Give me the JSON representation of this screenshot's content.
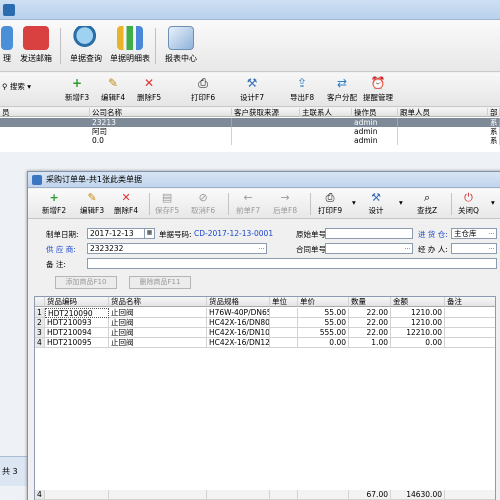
{
  "bg_app": {
    "big_toolbar": [
      {
        "label": "理",
        "icon": "settings-icon"
      },
      {
        "label": "发送邮箱",
        "icon": "mail-icon"
      },
      {
        "label": "单据查询",
        "icon": "search-icon"
      },
      {
        "label": "单据明细表",
        "icon": "bar-chart-icon"
      },
      {
        "label": "报表中心",
        "icon": "report-icon"
      }
    ],
    "search_label": "搜索",
    "toolbar": [
      {
        "label": "新增F3",
        "icon": "+"
      },
      {
        "label": "编辑F4",
        "icon": "✎"
      },
      {
        "label": "删除F5",
        "icon": "✕"
      },
      {
        "label": "打印F6",
        "icon": "⎙"
      },
      {
        "label": "设计F7",
        "icon": "⚒"
      },
      {
        "label": "导出F8",
        "icon": "⇪"
      },
      {
        "label": "客户分配",
        "icon": "⇄"
      },
      {
        "label": "提醒管理",
        "icon": "⏰"
      }
    ],
    "grid": {
      "headers": [
        "员",
        "公司名称",
        "客户获取来源",
        "主联系人",
        "操作员",
        "跟单人员",
        "部"
      ],
      "rows": [
        {
          "company": "23213",
          "operator": "admin",
          "dept": "系"
        },
        {
          "company": "阿司",
          "operator": "admin",
          "dept": "系"
        },
        {
          "company": "0.0",
          "operator": "admin",
          "dept": "系"
        }
      ]
    },
    "bottom_tab": "共 3"
  },
  "order_window": {
    "title": "采购订单单-共1张此类单据",
    "toolbar": [
      {
        "label": "新增F2",
        "icon": "+",
        "enabled": true
      },
      {
        "label": "编辑F3",
        "icon": "✎",
        "enabled": true
      },
      {
        "label": "删除F4",
        "icon": "✕",
        "enabled": true
      },
      {
        "label": "保存F5",
        "icon": "▤",
        "enabled": false
      },
      {
        "label": "取消F6",
        "icon": "⊘",
        "enabled": false
      },
      {
        "label": "前单F7",
        "icon": "←",
        "enabled": false
      },
      {
        "label": "后单F8",
        "icon": "→",
        "enabled": false
      },
      {
        "label": "打印F9",
        "icon": "⎙",
        "enabled": true
      },
      {
        "label": "设计",
        "icon": "⚒",
        "enabled": true
      },
      {
        "label": "查找Z",
        "icon": "⌕",
        "enabled": true
      },
      {
        "label": "关闭Q",
        "icon": "⏻",
        "enabled": true
      }
    ],
    "form": {
      "date_label": "制单日期:",
      "date_value": "2017-12-13",
      "doc_no_label": "单据号码:",
      "doc_no_value": "CD-2017-12-13-0001",
      "source_no_label": "原始单号:",
      "source_no_value": "",
      "warehouse_label": "进 货 仓:",
      "warehouse_value": "主仓库",
      "supplier_label": "供 应 商:",
      "supplier_value": "2323232",
      "contract_label": "合同单号:",
      "contract_value": "",
      "handler_label": "经 办 人:",
      "handler_value": "",
      "remark_label": "备    注:",
      "remark_value": "",
      "add_item_button": "添加商品F10",
      "delete_item_button": "删除商品F11"
    },
    "items": {
      "headers": [
        "",
        "货品编码",
        "货品名称",
        "货品规格",
        "单位",
        "单价",
        "数量",
        "金额",
        "备注"
      ],
      "rows": [
        {
          "n": "1",
          "code": "HDT210090",
          "name": "止回阀",
          "spec": "H76W-40P/DN65",
          "unit": "",
          "price": "55.00",
          "qty": "22.00",
          "amount": "1210.00",
          "note": ""
        },
        {
          "n": "2",
          "code": "HDT210093",
          "name": "止回阀",
          "spec": "HC42X-16/DN80",
          "unit": "",
          "price": "55.00",
          "qty": "22.00",
          "amount": "1210.00",
          "note": ""
        },
        {
          "n": "3",
          "code": "HDT210094",
          "name": "止回阀",
          "spec": "HC42X-16/DN100",
          "unit": "",
          "price": "555.00",
          "qty": "22.00",
          "amount": "12210.00",
          "note": ""
        },
        {
          "n": "4",
          "code": "HDT210095",
          "name": "止回阀",
          "spec": "HC42X-16/DN125",
          "unit": "",
          "price": "0.00",
          "qty": "1.00",
          "amount": "0.00",
          "note": ""
        }
      ],
      "totals": {
        "n": "4",
        "qty": "67.00",
        "amount": "14630.00"
      }
    }
  }
}
